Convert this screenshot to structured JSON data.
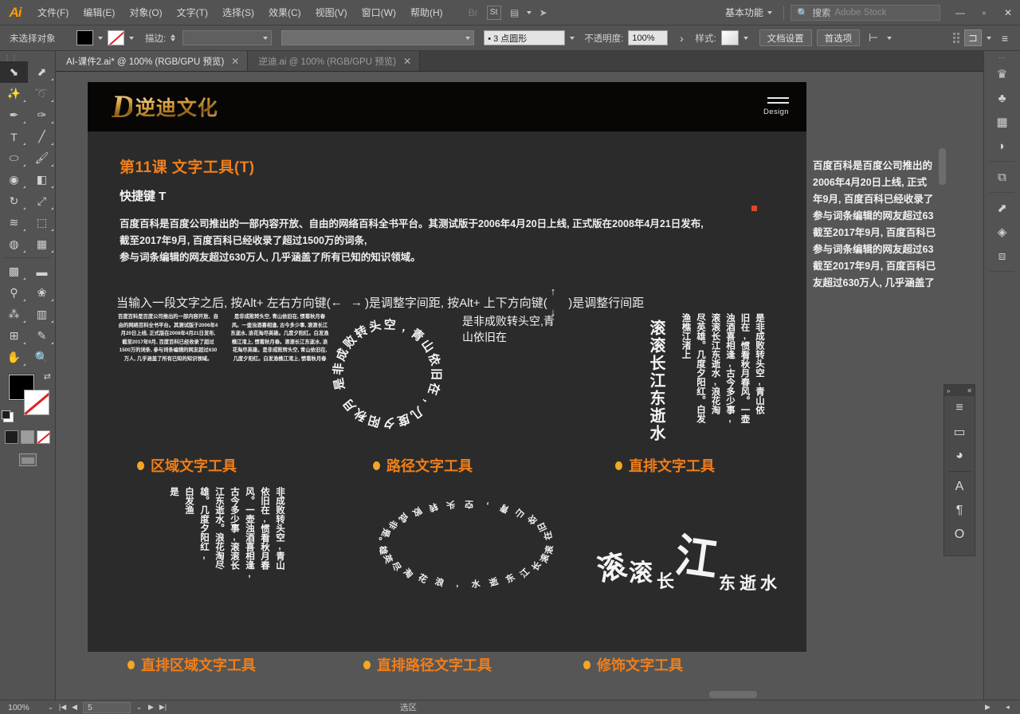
{
  "app": {
    "name": "Adobe Illustrator",
    "logo": "Ai"
  },
  "menubar": {
    "items": [
      {
        "label": "文件(F)",
        "name": "menu-file"
      },
      {
        "label": "编辑(E)",
        "name": "menu-edit"
      },
      {
        "label": "对象(O)",
        "name": "menu-object"
      },
      {
        "label": "文字(T)",
        "name": "menu-type"
      },
      {
        "label": "选择(S)",
        "name": "menu-select"
      },
      {
        "label": "效果(C)",
        "name": "menu-effect"
      },
      {
        "label": "视图(V)",
        "name": "menu-view"
      },
      {
        "label": "窗口(W)",
        "name": "menu-window"
      },
      {
        "label": "帮助(H)",
        "name": "menu-help"
      }
    ],
    "bridge_icon": "Br",
    "stock_icon": "St",
    "arrange_icon": "▤",
    "rocket_icon": "➤",
    "workspace": "基本功能",
    "search_label": "搜索",
    "search_placeholder": "Adobe Stock",
    "window_minimize": "—",
    "window_maximize": "▫",
    "window_close": "✕"
  },
  "controlbar": {
    "selection_status": "未选择对象",
    "fill_color": "#000000",
    "stroke_color": "none",
    "stroke_label": "描边:",
    "stroke_weight": "",
    "profile_value": "",
    "brush_def": "• 3 点圆形",
    "opacity_label": "不透明度:",
    "opacity_value": "100%",
    "style_label": "样式:",
    "doc_setup_button": "文档设置",
    "preferences_button": "首选项",
    "align_icon": "⊢",
    "arrange_icon": "⊐",
    "options_icon": "≡"
  },
  "tabs": [
    {
      "label": "AI-课件2.ai* @ 100% (RGB/GPU 预览)",
      "active": true,
      "close": "✕"
    },
    {
      "label": "逆迪.ai @ 100% (RGB/GPU 预览)",
      "active": false,
      "close": "✕"
    }
  ],
  "toolbar": {
    "grip": "⋮⋮",
    "tools": [
      {
        "name": "selection-tool",
        "glyph": "⬊",
        "selected": true
      },
      {
        "name": "direct-selection-tool",
        "glyph": "⬈"
      },
      {
        "name": "magic-wand-tool",
        "glyph": "✨"
      },
      {
        "name": "lasso-tool",
        "glyph": "➰"
      },
      {
        "name": "pen-tool",
        "glyph": "✒"
      },
      {
        "name": "curvature-tool",
        "glyph": "✑"
      },
      {
        "name": "type-tool",
        "glyph": "T"
      },
      {
        "name": "line-segment-tool",
        "glyph": "╱"
      },
      {
        "name": "ellipse-tool",
        "glyph": "⬭"
      },
      {
        "name": "paintbrush-tool",
        "glyph": "🖌"
      },
      {
        "name": "shaper-tool",
        "glyph": "◉"
      },
      {
        "name": "eraser-tool",
        "glyph": "◧"
      },
      {
        "name": "rotate-tool",
        "glyph": "↻"
      },
      {
        "name": "scale-tool",
        "glyph": "⤢"
      },
      {
        "name": "width-tool",
        "glyph": "≋"
      },
      {
        "name": "free-transform-tool",
        "glyph": "⬚"
      },
      {
        "name": "shape-builder-tool",
        "glyph": "◍"
      },
      {
        "name": "perspective-grid-tool",
        "glyph": "▦"
      },
      {
        "name": "mesh-tool",
        "glyph": "▩"
      },
      {
        "name": "gradient-tool",
        "glyph": "▬"
      },
      {
        "name": "eyedropper-tool",
        "glyph": "⚲"
      },
      {
        "name": "blend-tool",
        "glyph": "❀"
      },
      {
        "name": "symbol-sprayer-tool",
        "glyph": "⁂"
      },
      {
        "name": "column-graph-tool",
        "glyph": "▥"
      },
      {
        "name": "artboard-tool",
        "glyph": "⊞"
      },
      {
        "name": "slice-tool",
        "glyph": "✎"
      },
      {
        "name": "hand-tool",
        "glyph": "✋"
      },
      {
        "name": "zoom-tool",
        "glyph": "🔍"
      }
    ],
    "fill_swatch": "#000000",
    "stroke_swatch": "none",
    "swap_icon": "⇄",
    "color_mode_icons": [
      "color",
      "gradient",
      "none"
    ],
    "screen_mode_icon": "▭"
  },
  "artboard": {
    "logo": {
      "monogram": "D",
      "text": "逆迪文化"
    },
    "nav": {
      "menu_icon": "hamburger-icon",
      "label": "Design"
    },
    "lesson_title": "第11课   文字工具(T)",
    "shortcut": "快捷键 T",
    "paragraph": [
      "百度百科是百度公司推出的一部内容开放、自由的网络百科全书平台。其测试版于2006年4月20日上线, 正式版在2008年4月21日发布,",
      "截至2017年9月, 百度百科已经收录了超过1500万的词条,",
      "参与词条编辑的网友超过630万人, 几乎涵盖了所有已知的知识领域。"
    ],
    "alt_hint": {
      "prefix": "当输入一段文字之后, 按Alt+ 左右方向键(",
      "lr_arrows": "←  →",
      "mid": ")是调整字间距, 按Alt+ 上下方向键(",
      "up_arrow": "↑",
      "down_arrow": "↓",
      "suffix": ")是调整行间距"
    },
    "samples": {
      "area_text": "百度百科是百度公司推出的一部内容开放、自由的网络百科全书平台。其测试版于2006年4月20日上线, 正式版在2008年4月21日发布, 截至2017年9月, 百度百科已经收录了超过1500万的词条, 参与词条编辑的网友超过630万人, 几乎涵盖了所有已知的知识领域。",
      "area_text_2": "是非成败转头空, 青山依旧在, 惯看秋月春风。一壶浊酒喜相逢, 古今多少事, 滚滚长江东逝水, 浪花淘尽英雄。几度夕阳红。白发渔樵江渚上, 惯看秋月春。滚滚长江东逝水, 浪花淘尽英雄。是非成败转头空, 青山依旧在, 几度夕阳红。白发渔樵江渚上, 惯看秋月春",
      "path_text_circle": "是非成败转头空,青山依旧在,几度夕阳秋月",
      "path_text_circle_2": "是非成败转头空,青山依旧在",
      "vertical_big": "滚滚长江东逝水",
      "vertical_poem": [
        "是非成败转头空,青山依",
        "旧在,惯看秋月春风。一壶",
        "浊酒喜相逢,古今多少事,",
        "滚滚长江东逝水,浪花淘",
        "尽英雄。几度夕阳红。白发",
        "渔樵江渚上"
      ],
      "vertical_area": [
        "非成败转头空,青山",
        "依旧在,惯看秋月春",
        "风。一壶浊酒喜相逢,",
        "古今多少事,滚滚长",
        "江东逝水。浪花淘尽",
        "雄。几度夕阳红,",
        "白发渔",
        "是"
      ],
      "vertical_path_ellipse": "滚滚长江东逝水,浪花淘尽英雄。是非成败转头空,青山依旧在",
      "touch_type": "滚滚长江东逝水"
    },
    "captions_row1": [
      {
        "label": "区域文字工具",
        "name": "caption-area-type-tool"
      },
      {
        "label": "路径文字工具",
        "name": "caption-type-on-path-tool"
      },
      {
        "label": "直排文字工具",
        "name": "caption-vertical-type-tool"
      }
    ],
    "captions_row2": [
      {
        "label": "直排区域文字工具",
        "name": "caption-vertical-area-type-tool"
      },
      {
        "label": "直排路径文字工具",
        "name": "caption-vertical-type-on-path-tool"
      },
      {
        "label": "修饰文字工具",
        "name": "caption-touch-type-tool"
      }
    ],
    "overflow_text": [
      "百度百科是百度公司推出的",
      "2006年4月20日上线, 正式",
      "年9月, 百度百科已经收录了",
      "参与词条编辑的网友超过63",
      "截至2017年9月, 百度百科已",
      "参与词条编辑的网友超过63",
      "截至2017年9月, 百度百科已",
      "友超过630万人, 几乎涵盖了"
    ]
  },
  "right_dock": {
    "icons": [
      {
        "name": "brush-libraries-icon",
        "glyph": "♛"
      },
      {
        "name": "symbols-icon",
        "glyph": "♣"
      },
      {
        "name": "image-trace-icon",
        "glyph": "▦"
      },
      {
        "name": "gradient-icon",
        "glyph": "◗"
      },
      {
        "name": "transform-icon",
        "glyph": "⧉"
      },
      {
        "name": "artboards-icon",
        "glyph": "⬈"
      },
      {
        "name": "layers-icon",
        "glyph": "◈"
      },
      {
        "name": "pathfinder-icon",
        "glyph": "⧈"
      }
    ]
  },
  "float_panel": {
    "collapse_icon": "»",
    "close_icon": "✕",
    "icons": [
      {
        "name": "align-icon",
        "glyph": "≡"
      },
      {
        "name": "artboard-panel-icon",
        "glyph": "▭"
      },
      {
        "name": "color-panel-icon",
        "glyph": "◕"
      },
      {
        "name": "character-panel-icon",
        "glyph": "A"
      },
      {
        "name": "paragraph-panel-icon",
        "glyph": "¶"
      },
      {
        "name": "opacity-panel-icon",
        "glyph": "O"
      }
    ]
  },
  "statusbar": {
    "zoom": "100%",
    "zoom_caret": "⌄",
    "first_page": "|◀",
    "prev_page": "◀",
    "page_number": "5",
    "page_caret": "⌄",
    "next_page": "▶",
    "last_page": "▶|",
    "status_text": "选区",
    "play_icon": "▶",
    "grip_icon": "◂"
  },
  "colors": {
    "accent_orange": "#f07f1a",
    "bullet_orange": "#f5a623",
    "artboard_bg": "#2b2b2b",
    "header_black": "#080604",
    "ui_gray": "#535353"
  }
}
